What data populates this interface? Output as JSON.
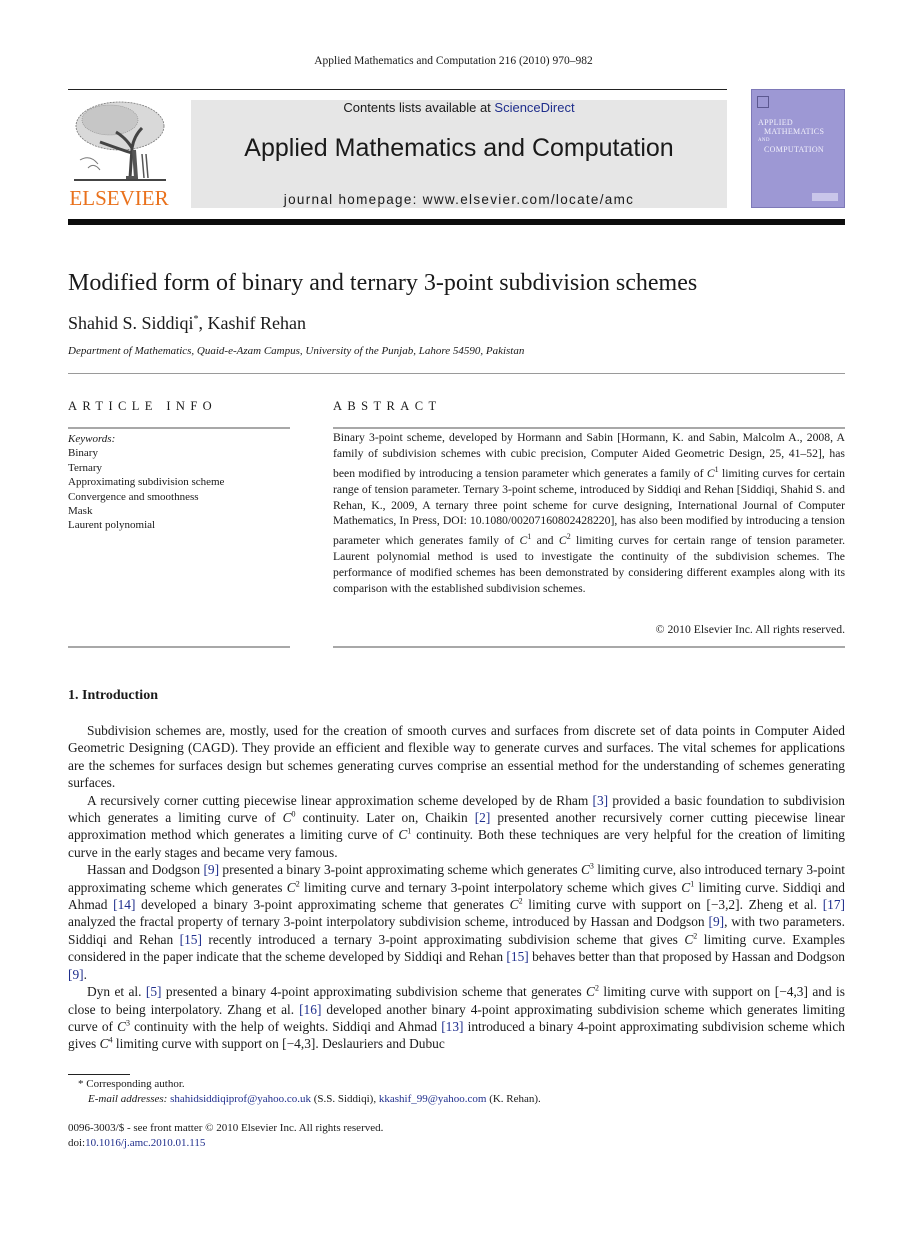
{
  "header": {
    "running_head": "Applied Mathematics and Computation 216 (2010) 970–982",
    "publisher_logo_text": "ELSEVIER",
    "contents_prefix": "Contents lists available at ",
    "contents_link": "ScienceDirect",
    "journal_title": "Applied Mathematics and Computation",
    "homepage_prefix": "journal homepage: ",
    "homepage_url": "www.elsevier.com/locate/amc",
    "cover": {
      "line1": "APPLIED",
      "line2": "MATHEMATICS",
      "line3": "AND",
      "line4": "COMPUTATION",
      "color": "#9d98d4"
    }
  },
  "article": {
    "title": "Modified form of binary and ternary 3-point subdivision schemes",
    "authors": [
      {
        "name": "Shahid S. Siddiqi",
        "mark": "*"
      },
      {
        "name": "Kashif Rehan",
        "mark": ""
      }
    ],
    "author_separator": ", ",
    "affiliation": "Department of Mathematics, Quaid-e-Azam Campus, University of the Punjab, Lahore 54590, Pakistan"
  },
  "article_info": {
    "label": "ARTICLE INFO",
    "keywords_label": "Keywords:",
    "keywords": [
      "Binary",
      "Ternary",
      "Approximating subdivision scheme",
      "Convergence and smoothness",
      "Mask",
      "Laurent polynomial"
    ]
  },
  "abstract": {
    "label": "ABSTRACT",
    "parts": {
      "p1": "Binary 3-point scheme, developed by Hormann and Sabin [Hormann, K. and Sabin, Malcolm A., 2008, A family of subdivision schemes with cubic precision, Computer Aided Geometric Design, 25, 41–52], has been modified by introducing a tension parameter which generates a family of ",
      "c": "C",
      "sup1": "1",
      "p2": " limiting curves for certain range of tension parameter. Ternary 3-point scheme, introduced by Siddiqi and Rehan [Siddiqi, Shahid S. and Rehan, K., 2009, A ternary three point scheme for curve designing, International Journal of Computer Mathematics, In Press, DOI: 10.1080/00207160802428220], has also been modified by introducing a tension parameter which generates family of ",
      "sup2": "1",
      "and": " and ",
      "sup3": "2",
      "p3": " limiting curves for certain range of tension parameter. Laurent polynomial method is used to investigate the continuity of the subdivision schemes. The performance of modified schemes has been demonstrated by considering different examples along with its comparison with the established subdivision schemes."
    },
    "copyright": "© 2010 Elsevier Inc. All rights reserved."
  },
  "section": {
    "heading": "1.  Introduction",
    "paragraphs": [
      {
        "segments": [
          {
            "t": "Subdivision schemes are, mostly, used for the creation of smooth curves and surfaces from discrete set of data points in Computer Aided Geometric Designing (CAGD). They provide an efficient and flexible way to generate curves and surfaces. The vital schemes for applications are the schemes for surfaces design but schemes generating curves comprise an essential method for the understanding of schemes generating surfaces."
          }
        ]
      },
      {
        "segments": [
          {
            "t": "A recursively corner cutting piecewise linear approximation scheme developed by de Rham "
          },
          {
            "ref": "[3]"
          },
          {
            "t": " provided a basic foundation to subdivision which generates a limiting curve of "
          },
          {
            "c": "C",
            "sup": "0"
          },
          {
            "t": " continuity. Later on, Chaikin "
          },
          {
            "ref": "[2]"
          },
          {
            "t": " presented another recursively corner cutting piecewise linear approximation method which generates a limiting curve of "
          },
          {
            "c": "C",
            "sup": "1"
          },
          {
            "t": " continuity. Both these techniques are very helpful for the creation of limiting curve in the early stages and became very famous."
          }
        ]
      },
      {
        "segments": [
          {
            "t": "Hassan and Dodgson "
          },
          {
            "ref": "[9]"
          },
          {
            "t": " presented a binary 3-point approximating scheme which generates "
          },
          {
            "c": "C",
            "sup": "3"
          },
          {
            "t": " limiting curve, also introduced ternary 3-point approximating scheme which generates "
          },
          {
            "c": "C",
            "sup": "2"
          },
          {
            "t": " limiting curve and ternary 3-point interpolatory scheme which gives "
          },
          {
            "c": "C",
            "sup": "1"
          },
          {
            "t": " limiting curve. Siddiqi and Ahmad "
          },
          {
            "ref": "[14]"
          },
          {
            "t": " developed a binary 3-point approximating scheme that generates "
          },
          {
            "c": "C",
            "sup": "2"
          },
          {
            "t": " limiting curve with support on [−3,2]. Zheng et al. "
          },
          {
            "ref": "[17]"
          },
          {
            "t": " analyzed the fractal property of ternary 3-point interpolatory subdivision scheme, introduced by Hassan and Dodgson "
          },
          {
            "ref": "[9]"
          },
          {
            "t": ", with two parameters. Siddiqi and Rehan "
          },
          {
            "ref": "[15]"
          },
          {
            "t": " recently introduced a ternary 3-point approximating subdivision scheme that gives "
          },
          {
            "c": "C",
            "sup": "2"
          },
          {
            "t": " limiting curve. Examples considered in the paper indicate that the scheme developed by Siddiqi and Rehan "
          },
          {
            "ref": "[15]"
          },
          {
            "t": " behaves better than that proposed by Hassan and Dodgson "
          },
          {
            "ref": "[9]"
          },
          {
            "t": "."
          }
        ]
      },
      {
        "segments": [
          {
            "t": "Dyn et al. "
          },
          {
            "ref": "[5]"
          },
          {
            "t": " presented a binary 4-point approximating subdivision scheme that generates "
          },
          {
            "c": "C",
            "sup": "2"
          },
          {
            "t": " limiting curve with support on [−4,3] and is close to being interpolatory. Zhang et al. "
          },
          {
            "ref": "[16]"
          },
          {
            "t": " developed another binary 4-point approximating subdivision scheme which generates limiting curve of "
          },
          {
            "c": "C",
            "sup": "3"
          },
          {
            "t": " continuity with the help of weights. Siddiqi and Ahmad "
          },
          {
            "ref": "[13]"
          },
          {
            "t": " introduced a binary 4-point approximating subdivision scheme which gives "
          },
          {
            "c": "C",
            "sup": "4"
          },
          {
            "t": " limiting curve with support on [−4,3]. Deslauriers and Dubuc"
          }
        ]
      }
    ]
  },
  "footnotes": {
    "star": "*",
    "corresponding": "Corresponding author.",
    "email_label": "E-mail addresses:",
    "email1": "shahidsiddiqiprof@yahoo.co.uk",
    "email1_owner": " (S.S. Siddiqi), ",
    "email2": "kkashif_99@yahoo.com",
    "email2_owner": " (K. Rehan)."
  },
  "front_matter": {
    "issn_line": "0096-3003/$ - see front matter © 2010 Elsevier Inc. All rights reserved.",
    "doi_prefix": "doi:",
    "doi": "10.1016/j.amc.2010.01.115"
  },
  "colors": {
    "link": "#1f2e8c",
    "elsevier_orange": "#e9711c",
    "masthead_bg": "#e6e6e6"
  }
}
